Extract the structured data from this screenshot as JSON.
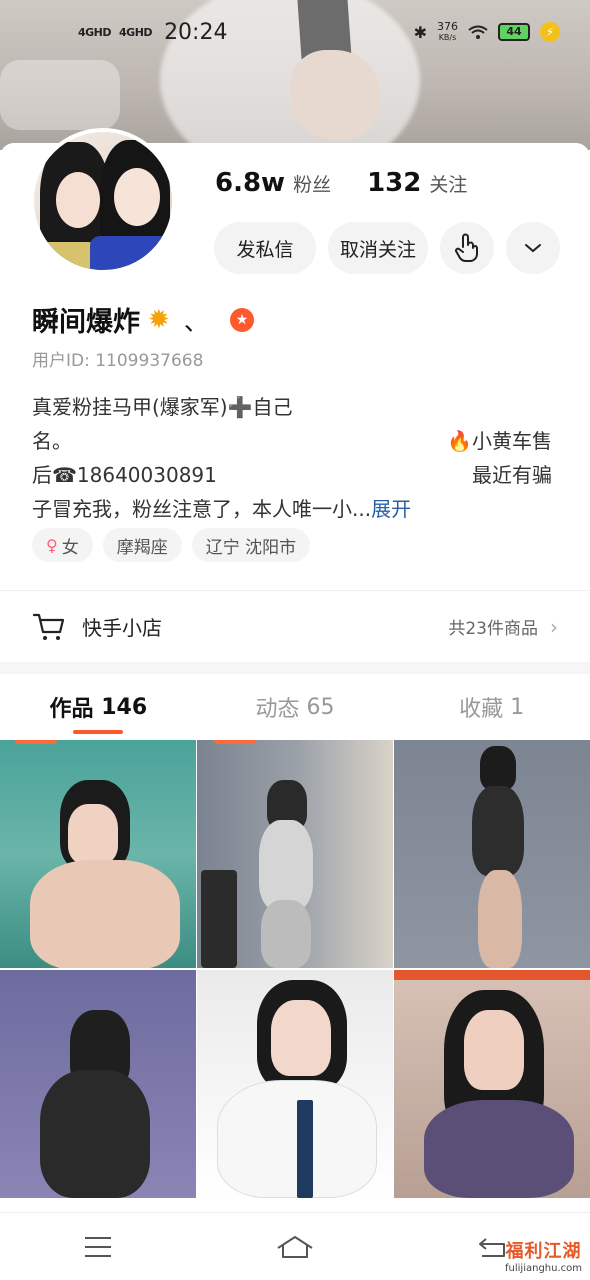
{
  "status": {
    "signal1": "4GHD",
    "signal2": "4GHD",
    "time": "20:24",
    "speed_value": "376",
    "speed_unit": "KB/s",
    "battery": "44"
  },
  "profile": {
    "followers": "6.8w",
    "followers_label": "粉丝",
    "following": "132",
    "following_label": "关注",
    "name": "瞬间爆炸",
    "name_suffix": "、",
    "user_id": "用户ID: 1109937668",
    "bio": [
      "真爱粉挂马甲(爆家军)➕自己",
      "名。",
      "后☎18640030891",
      "子冒充我，粉丝注意了，本人唯一小..."
    ],
    "bio_right": [
      "🔥小黄车售",
      "最近有骗"
    ],
    "expand": "展开",
    "tags": [
      "女",
      "摩羯座",
      "辽宁 沈阳市"
    ]
  },
  "actions": {
    "message": "发私信",
    "unfollow": "取消关注"
  },
  "shop": {
    "label": "快手小店",
    "count": "共23件商品"
  },
  "tabs": [
    {
      "label": "作品",
      "count": "146"
    },
    {
      "label": "动态",
      "count": "65"
    },
    {
      "label": "收藏",
      "count": "1"
    }
  ],
  "watermark": {
    "cn": "福利江湖",
    "url": "fulijianghu.com"
  },
  "colors": {
    "accent": "#ff5a2e",
    "link": "#2a5ea8"
  }
}
